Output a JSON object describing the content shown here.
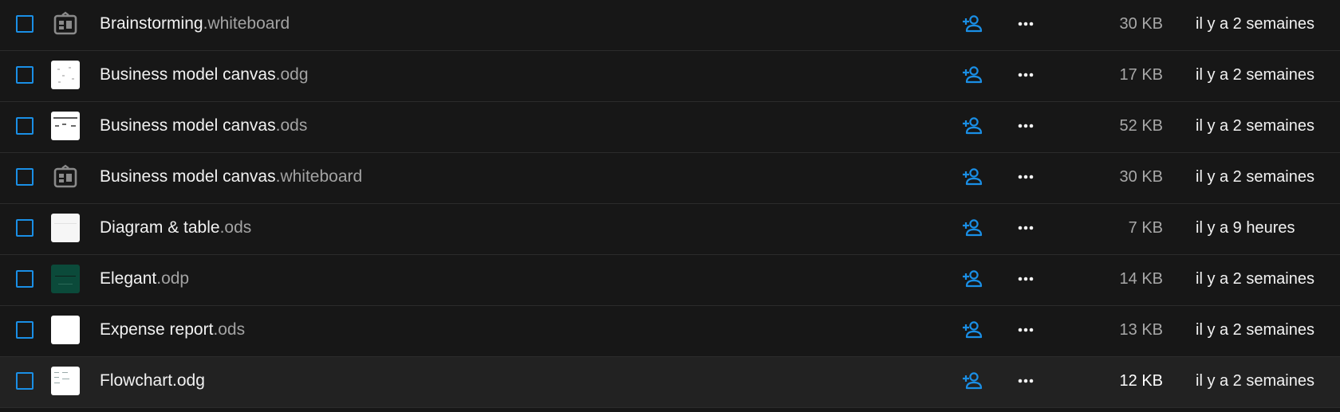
{
  "colors": {
    "background": "#171717",
    "hover_row": "#222222",
    "accent": "#1a8fe6",
    "text": "#f2f2f2",
    "muted": "#a3a3a3"
  },
  "files": [
    {
      "base": "Brainstorming",
      "ext": ".whiteboard",
      "size": "30 KB",
      "modified": "il y a 2 semaines",
      "thumb": "whiteboard-icon"
    },
    {
      "base": "Business model canvas",
      "ext": ".odg",
      "size": "17 KB",
      "modified": "il y a 2 semaines",
      "thumb": "drawing-thumbnail"
    },
    {
      "base": "Business model canvas",
      "ext": ".ods",
      "size": "52 KB",
      "modified": "il y a 2 semaines",
      "thumb": "spreadsheet-thumbnail"
    },
    {
      "base": "Business model canvas",
      "ext": ".whiteboard",
      "size": "30 KB",
      "modified": "il y a 2 semaines",
      "thumb": "whiteboard-icon"
    },
    {
      "base": "Diagram & table",
      "ext": ".ods",
      "size": "7 KB",
      "modified": "il y a 9 heures",
      "thumb": "spreadsheet-thumbnail"
    },
    {
      "base": "Elegant",
      "ext": ".odp",
      "size": "14 KB",
      "modified": "il y a 2 semaines",
      "thumb": "presentation-thumbnail"
    },
    {
      "base": "Expense report",
      "ext": ".ods",
      "size": "13 KB",
      "modified": "il y a 2 semaines",
      "thumb": "spreadsheet-thumbnail"
    },
    {
      "base": "Flowchart",
      "ext": ".odg",
      "size": "12 KB",
      "modified": "il y a 2 semaines",
      "thumb": "drawing-thumbnail"
    }
  ],
  "icons": {
    "share": "share-user-plus-icon",
    "more": "more-horizontal-icon"
  }
}
